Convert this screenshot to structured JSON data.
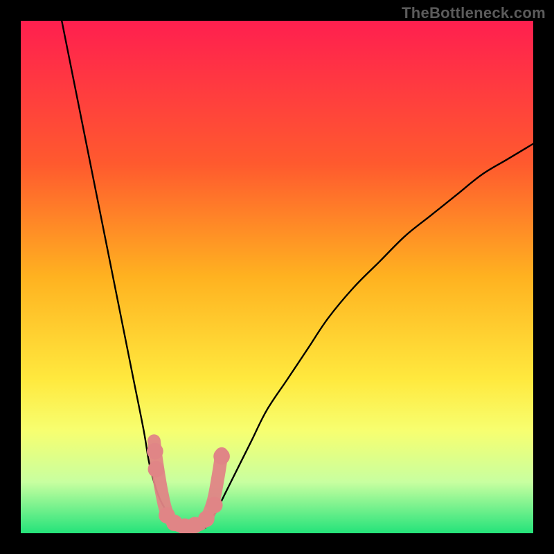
{
  "watermark": "TheBottleneck.com",
  "chart_data": {
    "type": "line",
    "title": "",
    "xlabel": "",
    "ylabel": "",
    "xlim": [
      0,
      100
    ],
    "ylim": [
      0,
      100
    ],
    "grid": false,
    "legend": false,
    "background_gradient": {
      "stops": [
        {
          "offset": 0.0,
          "color": "#ff1f4f"
        },
        {
          "offset": 0.28,
          "color": "#ff5a2e"
        },
        {
          "offset": 0.5,
          "color": "#ffb220"
        },
        {
          "offset": 0.7,
          "color": "#ffe93e"
        },
        {
          "offset": 0.8,
          "color": "#f7ff70"
        },
        {
          "offset": 0.9,
          "color": "#c8ffa0"
        },
        {
          "offset": 1.0,
          "color": "#24e37a"
        }
      ]
    },
    "series": [
      {
        "name": "left-arm",
        "stroke": "#000000",
        "x": [
          8,
          10,
          12,
          14,
          16,
          18,
          20,
          22,
          24,
          25,
          26,
          27,
          28,
          29,
          30
        ],
        "y": [
          100,
          90,
          80,
          70,
          60,
          50,
          40,
          30,
          20,
          14,
          10,
          7,
          5,
          3,
          1
        ]
      },
      {
        "name": "right-arm",
        "stroke": "#000000",
        "x": [
          36,
          38,
          40,
          42,
          45,
          48,
          52,
          56,
          60,
          65,
          70,
          75,
          80,
          85,
          90,
          95,
          100
        ],
        "y": [
          1,
          4,
          8,
          12,
          18,
          24,
          30,
          36,
          42,
          48,
          53,
          58,
          62,
          66,
          70,
          73,
          76
        ]
      }
    ],
    "trough": {
      "name": "trough-band",
      "stroke": "#e08586",
      "points": [
        {
          "x": 26.0,
          "y": 18.0
        },
        {
          "x": 26.5,
          "y": 14.0
        },
        {
          "x": 27.5,
          "y": 8.0
        },
        {
          "x": 28.5,
          "y": 4.0
        },
        {
          "x": 30.0,
          "y": 2.0
        },
        {
          "x": 32.0,
          "y": 1.2
        },
        {
          "x": 34.0,
          "y": 1.4
        },
        {
          "x": 36.0,
          "y": 2.6
        },
        {
          "x": 37.5,
          "y": 6.0
        },
        {
          "x": 38.5,
          "y": 11.0
        },
        {
          "x": 39.2,
          "y": 15.5
        }
      ]
    },
    "markers": {
      "name": "trough-dots",
      "color": "#e08586",
      "radius_chart_units": 1.6,
      "points": [
        {
          "x": 26.2,
          "y": 16.0
        },
        {
          "x": 26.4,
          "y": 12.5
        },
        {
          "x": 28.5,
          "y": 3.5
        },
        {
          "x": 30.0,
          "y": 2.0
        },
        {
          "x": 32.0,
          "y": 1.3
        },
        {
          "x": 34.0,
          "y": 1.6
        },
        {
          "x": 36.2,
          "y": 2.8
        },
        {
          "x": 37.8,
          "y": 5.5
        },
        {
          "x": 39.2,
          "y": 15.0
        }
      ]
    }
  }
}
